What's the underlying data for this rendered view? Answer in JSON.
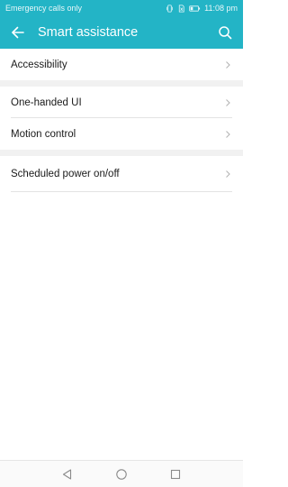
{
  "status_bar": {
    "carrier_text": "Emergency calls only",
    "time": "11:08 pm",
    "icons": [
      "vibrate-icon",
      "no-sim-icon",
      "battery-icon"
    ]
  },
  "toolbar": {
    "title": "Smart assistance",
    "back_icon": "arrow-left-icon",
    "search_icon": "search-icon"
  },
  "groups": [
    {
      "items": [
        {
          "label": "Accessibility"
        }
      ]
    },
    {
      "items": [
        {
          "label": "One-handed UI"
        },
        {
          "label": "Motion control"
        }
      ]
    },
    {
      "items": [
        {
          "label": "Scheduled power on/off"
        }
      ]
    }
  ],
  "nav_bar": {
    "icons": [
      "back-triangle-icon",
      "home-circle-icon",
      "recents-square-icon"
    ]
  },
  "colors": {
    "accent": "#23b4c6",
    "divider": "#e3e3e3",
    "group_gap": "#f1f1f1",
    "chevron": "#b5b5b5"
  }
}
